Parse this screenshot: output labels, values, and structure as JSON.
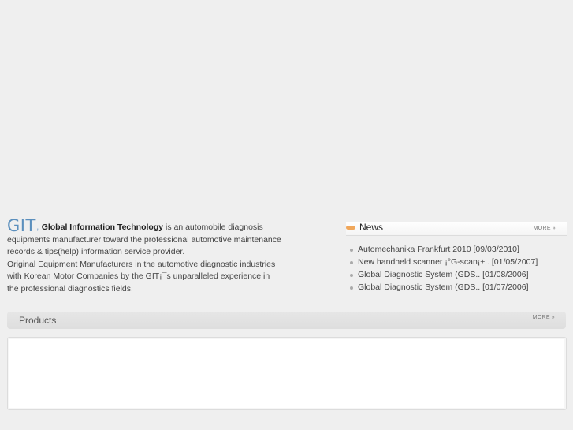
{
  "intro": {
    "logo": "GIT",
    "logo_sep": ",",
    "company_name": "Global Information Technology",
    "line1": " is an automobile diagnosis equipments manufacturer toward the professional automotive maintenance records & tips(help) information service provider.",
    "line2": "Original Equipment Manufacturers in the automotive diagnostic industries with Korean Motor Companies by the GIT¡¯s unparalleled experience in the professional diagnostics fields."
  },
  "news": {
    "title": "News",
    "more": "MORE",
    "more_arrows": "»",
    "items": [
      "Automechanika Frankfurt 2010 [09/03/2010]",
      "New handheld scanner ¡°G-scan¡±.. [01/05/2007]",
      "Global Diagnostic System (GDS.. [01/08/2006]",
      "Global Diagnostic System (GDS.. [01/07/2006]"
    ]
  },
  "products": {
    "title": "Products",
    "more": "MORE",
    "more_arrows": "»"
  },
  "colors": {
    "background": "#efefef",
    "logo": "#5b8fbd",
    "news_bullet": "#f0a75b"
  }
}
